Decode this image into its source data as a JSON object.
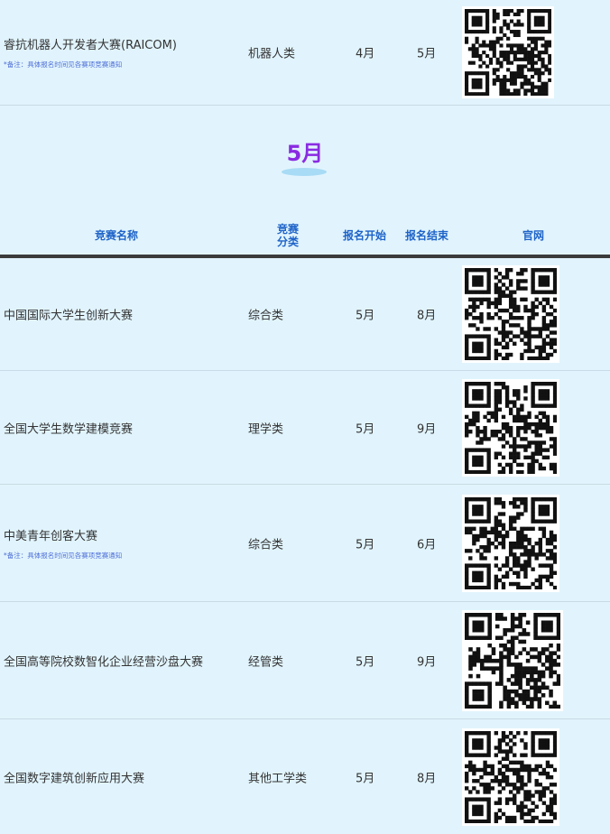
{
  "top_row": {
    "name": "睿抗机器人开发者大赛(RAICOM)",
    "note": "*备注：具体报名时间见各赛项竞赛通知",
    "category": "机器人类",
    "start": "4月",
    "end": "5月"
  },
  "month": {
    "title": "5月"
  },
  "table_header": {
    "name": "竞赛名称",
    "category_line1": "竞赛",
    "category_line2": "分类",
    "start": "报名开始",
    "end": "报名结束",
    "site": "官网"
  },
  "rows": [
    {
      "name": "中国国际大学生创新大赛",
      "note": "",
      "category": "综合类",
      "start": "5月",
      "end": "8月"
    },
    {
      "name": "全国大学生数学建模竞赛",
      "note": "",
      "category": "理学类",
      "start": "5月",
      "end": "9月"
    },
    {
      "name": "中美青年创客大赛",
      "note": "*备注：具体报名时间见各赛项竞赛通知",
      "category": "综合类",
      "start": "5月",
      "end": "6月"
    },
    {
      "name": "全国高等院校数智化企业经营沙盘大赛",
      "note": "",
      "category": "经管类",
      "start": "5月",
      "end": "9月"
    },
    {
      "name": "全国数字建筑创新应用大赛",
      "note": "",
      "category": "其他工学类",
      "start": "5月",
      "end": "8月"
    }
  ],
  "colors": {
    "background": "#e1f4fd",
    "header_text": "#1e63c8",
    "month_title": "#8a2be2",
    "note_text": "#4f6fd8"
  },
  "icons": {
    "qr": "qr-code-icon"
  }
}
